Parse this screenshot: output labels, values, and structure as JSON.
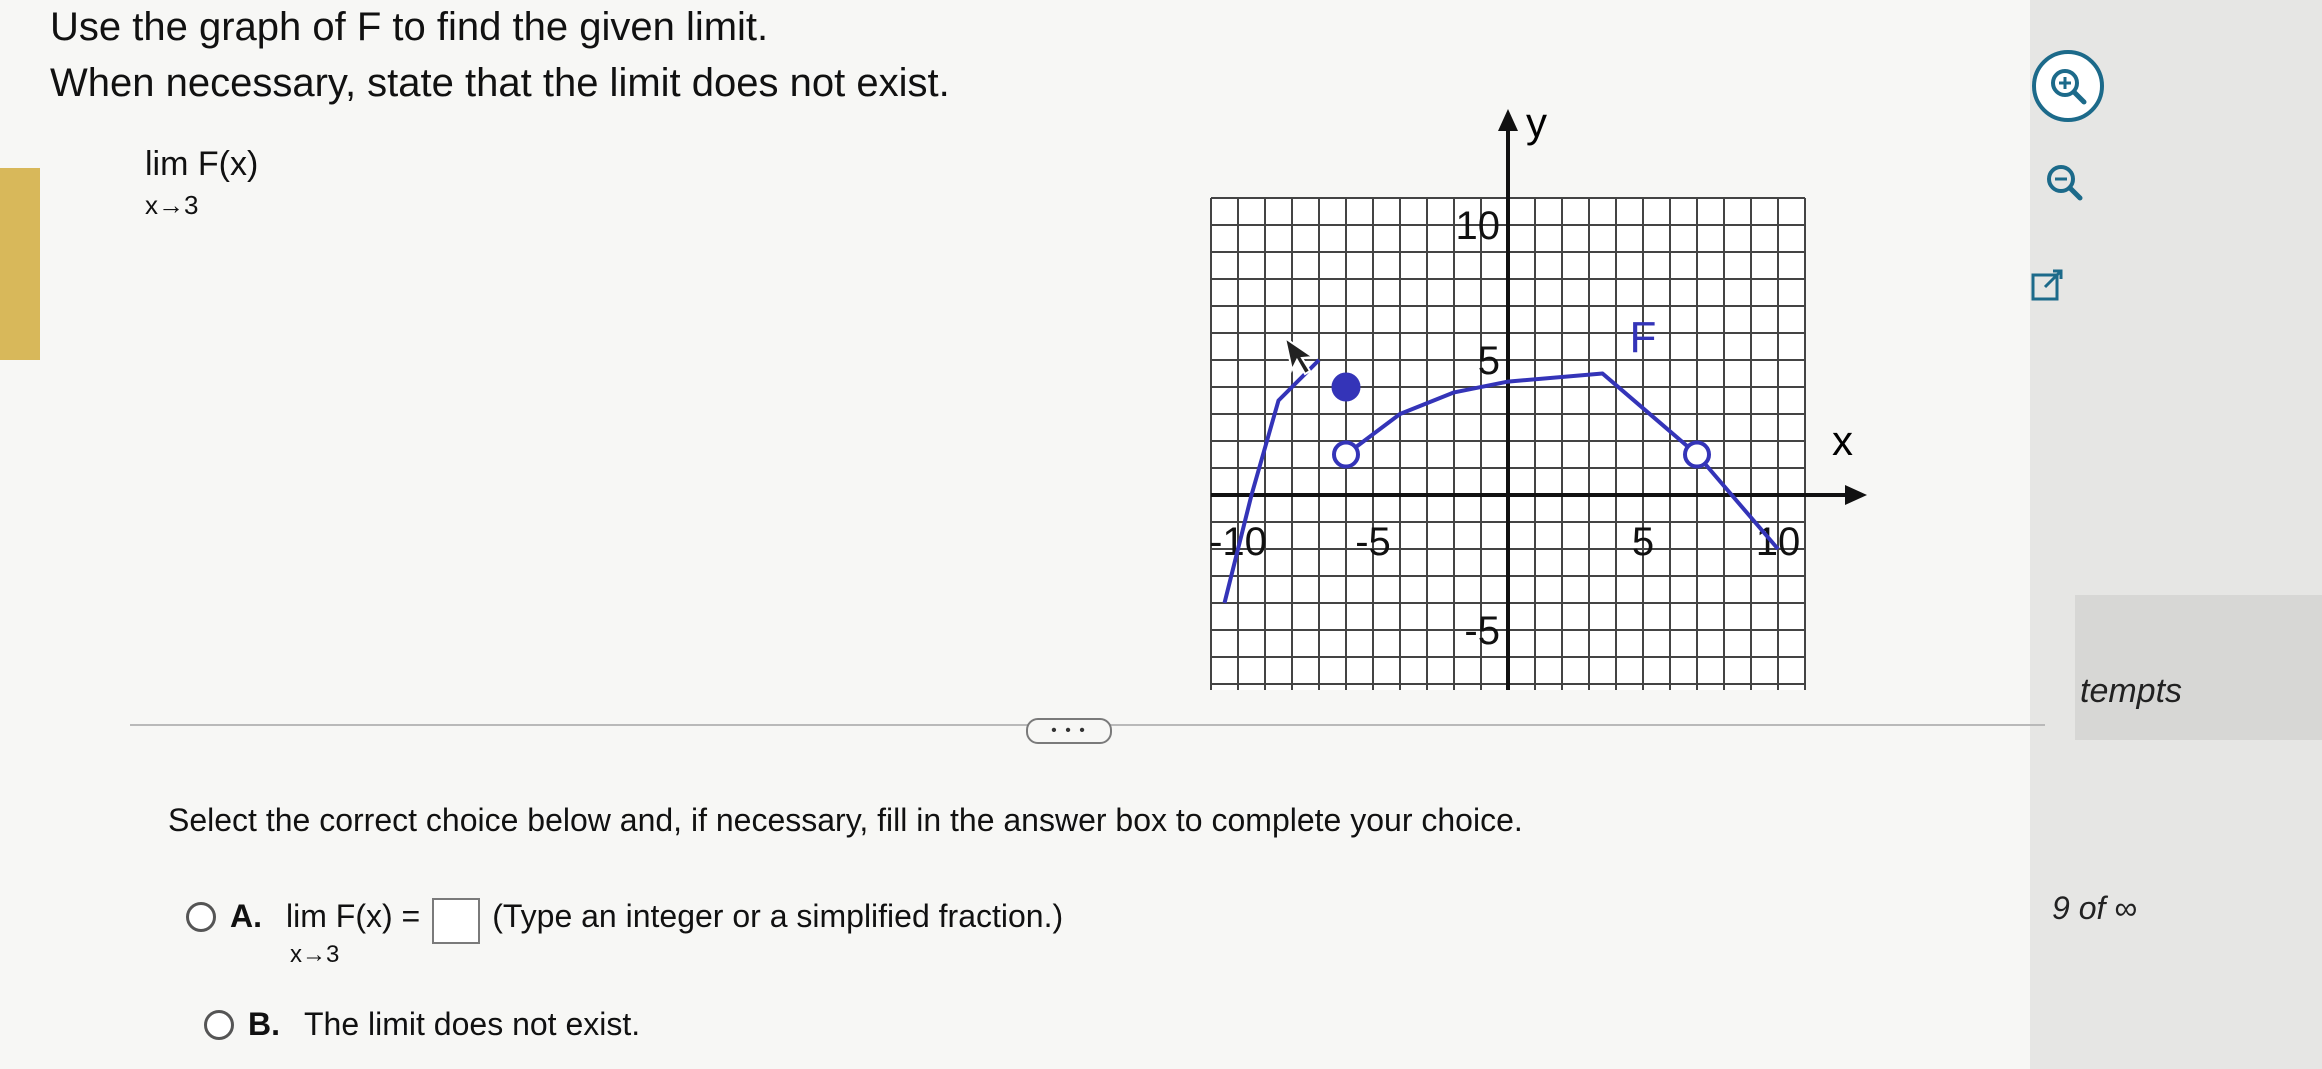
{
  "question": {
    "line1": "Use the graph of F to find the given limit.",
    "line2": "When necessary, state that the limit does not exist.",
    "limit_word": "lim F(x)",
    "limit_sub": "x→3"
  },
  "graph": {
    "y_axis_label": "y",
    "x_axis_label": "x",
    "curve_label": "F",
    "x_ticks": [
      {
        "label": "-10",
        "value": -10
      },
      {
        "label": "-5",
        "value": -5
      },
      {
        "label": "5",
        "value": 5
      },
      {
        "label": "10",
        "value": 10
      }
    ],
    "y_ticks": [
      {
        "label": "10",
        "value": 10
      },
      {
        "label": "5",
        "value": 5
      },
      {
        "label": "-5",
        "value": -5
      }
    ],
    "color": "#3434b8"
  },
  "chart_data": {
    "type": "line",
    "title": "",
    "xlabel": "x",
    "ylabel": "y",
    "xlim": [
      -10,
      10
    ],
    "ylim": [
      -8,
      11
    ],
    "grid": true,
    "series": [
      {
        "name": "F",
        "segment": 1,
        "points": [
          [
            -10.5,
            -4
          ],
          [
            -9.5,
            0
          ],
          [
            -8.5,
            3.5
          ],
          [
            -7,
            5
          ]
        ]
      },
      {
        "name": "F",
        "segment": 2,
        "points": [
          [
            -6,
            1.5
          ],
          [
            -4,
            3
          ],
          [
            -2,
            3.8
          ],
          [
            0,
            4.2
          ],
          [
            3.5,
            4.5
          ],
          [
            7,
            1.5
          ],
          [
            10,
            -2
          ]
        ]
      }
    ],
    "closed_points": [
      [
        -6,
        4
      ]
    ],
    "open_points": [
      [
        -6,
        1.5
      ],
      [
        7,
        1.5
      ]
    ]
  },
  "toolbar": {
    "zoom_in": "zoom-in",
    "zoom_out": "zoom-out",
    "popout": "pop-out"
  },
  "more_button": "• • •",
  "instruction": "Select the correct choice below and, if necessary, fill in the answer box to complete your choice.",
  "choices": {
    "a_letter": "A.",
    "a_lim": "lim F(x) =",
    "a_sub": "x→3",
    "a_hint": "(Type an integer or a simplified fraction.)",
    "b_letter": "B.",
    "b_text": "The limit does not exist."
  },
  "side": {
    "attempts": "tempts",
    "count": "9 of ∞"
  }
}
